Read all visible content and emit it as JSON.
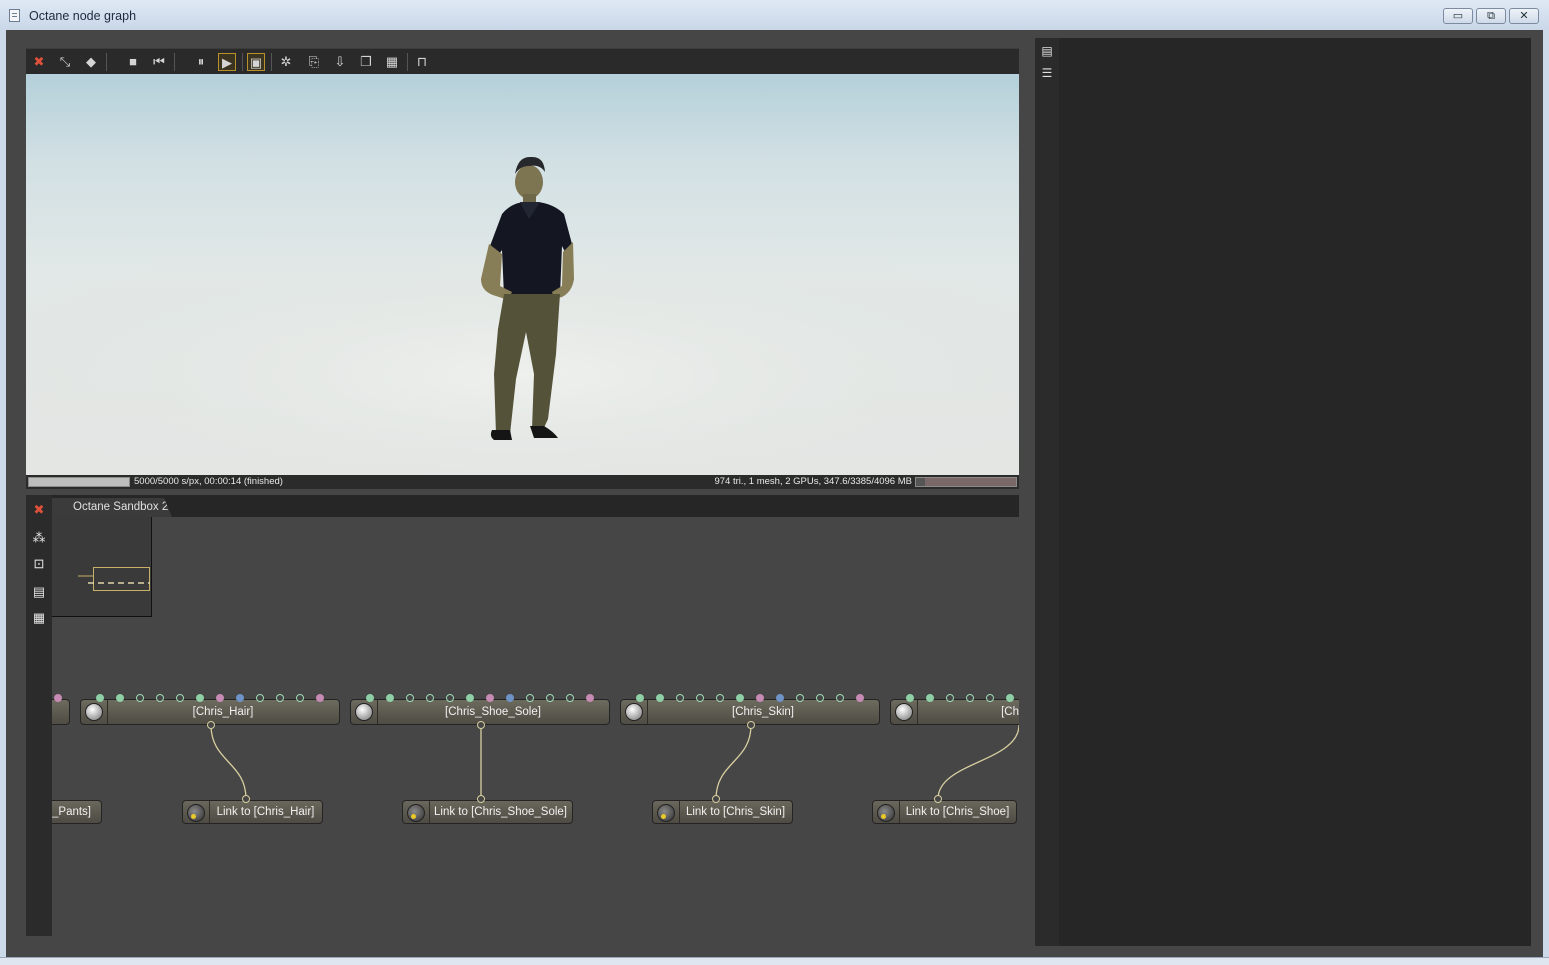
{
  "window": {
    "title": "Octane node graph",
    "minimize": "▭",
    "restore": "⧉",
    "close": "✕"
  },
  "toolbar": [
    {
      "icon": "reset-icon",
      "glyph": "✖"
    },
    {
      "icon": "fit-view-icon",
      "glyph": "⤡"
    },
    {
      "icon": "cube-icon",
      "glyph": "◆"
    },
    {
      "icon": "stop-icon",
      "glyph": "■"
    },
    {
      "icon": "rewind-icon",
      "glyph": "⏮"
    },
    {
      "icon": "pause-icon",
      "glyph": "⏸"
    },
    {
      "icon": "play-icon",
      "glyph": "▶"
    },
    {
      "icon": "viewport-lock-icon",
      "glyph": "▣"
    },
    {
      "icon": "focus-picker-icon",
      "glyph": "✲"
    },
    {
      "icon": "copy-icon",
      "glyph": "⎘"
    },
    {
      "icon": "save-render-icon",
      "glyph": "⇩"
    },
    {
      "icon": "layers-icon",
      "glyph": "❐"
    },
    {
      "icon": "region-render-icon",
      "glyph": "▦"
    },
    {
      "icon": "lock-icon",
      "glyph": "⊓"
    }
  ],
  "status": {
    "progress_left": 1.0,
    "left_text": "5000/5000 s/px, 00:00:14 (finished)",
    "right_text": "974 tri., 1 mesh, 2 GPUs, 347.6/3385/4096 MB",
    "memory_used_fraction": 0.085
  },
  "graph": {
    "tab_label": "Octane Sandbox 2",
    "side_tools": [
      {
        "icon": "reset-graph-icon",
        "glyph": "✖"
      },
      {
        "icon": "collapse-nodes-icon",
        "glyph": "⁂"
      },
      {
        "icon": "fit-graph-icon",
        "glyph": "⊡"
      },
      {
        "icon": "layout-icon",
        "glyph": "▤"
      },
      {
        "icon": "grid-icon",
        "glyph": "▦"
      }
    ],
    "material_nodes": [
      {
        "label": "",
        "pins": []
      },
      {
        "label": "[Chris_Hair]",
        "pins": [
          "g",
          "g",
          "o",
          "o",
          "o",
          "g",
          "p",
          "b",
          "o",
          "o",
          "o",
          "p"
        ]
      },
      {
        "label": "[Chris_Shoe_Sole]",
        "pins": [
          "g",
          "g",
          "o",
          "o",
          "o",
          "g",
          "p",
          "b",
          "o",
          "o",
          "o",
          "p"
        ]
      },
      {
        "label": "[Chris_Skin]",
        "pins": [
          "g",
          "g",
          "o",
          "o",
          "o",
          "g",
          "p",
          "b",
          "o",
          "o",
          "o",
          "p"
        ]
      },
      {
        "label": "[Ch",
        "pins": [
          "g",
          "g",
          "o",
          "o",
          "o",
          "g"
        ]
      }
    ],
    "link_nodes": [
      {
        "label": "_Pants]"
      },
      {
        "label": "Link to [Chris_Hair]"
      },
      {
        "label": "Link to [Chris_Shoe_Sole]"
      },
      {
        "label": "Link to [Chris_Skin]"
      },
      {
        "label": "Link to [Chris_Shoe]"
      }
    ]
  },
  "right_panel": {
    "tools": [
      {
        "icon": "panel-stack-icon",
        "glyph": "▤"
      },
      {
        "icon": "panel-list-icon",
        "glyph": "☰"
      }
    ]
  }
}
